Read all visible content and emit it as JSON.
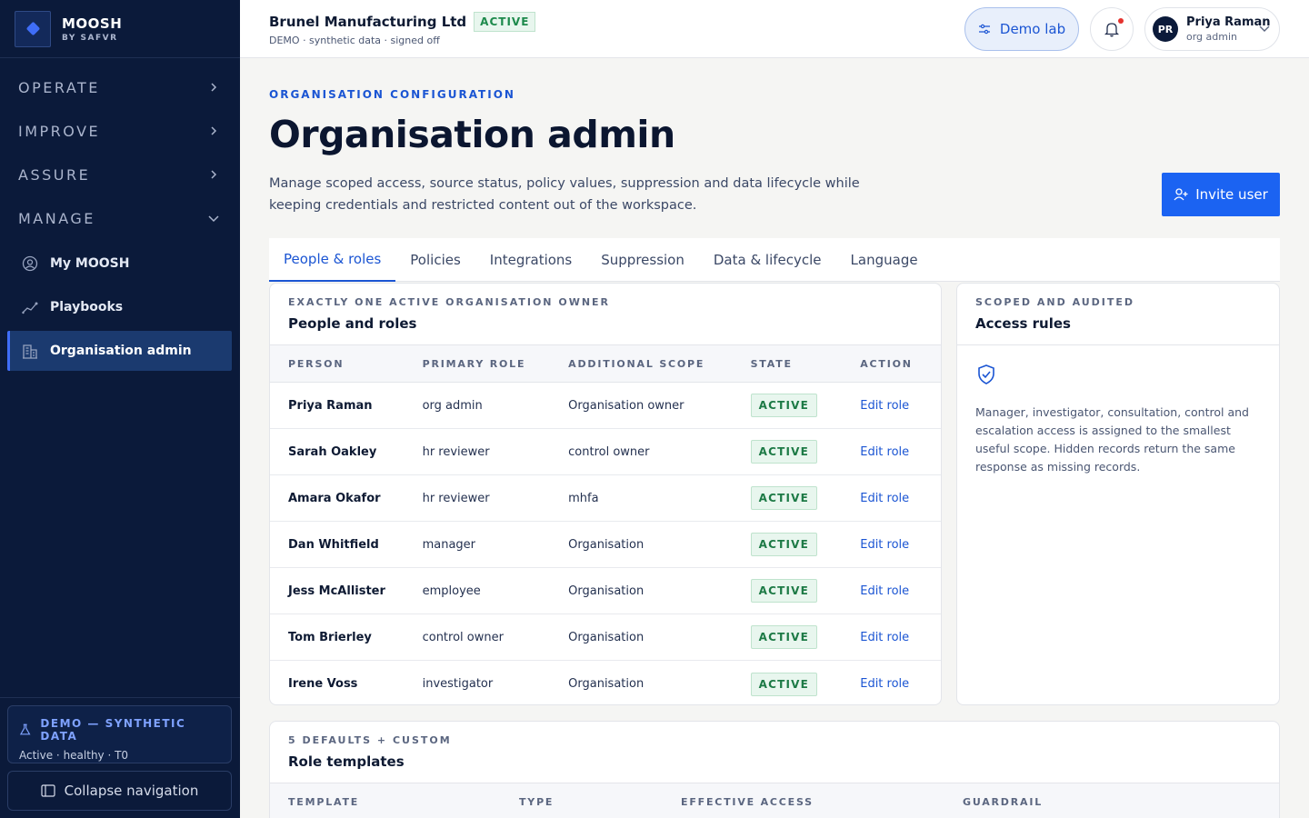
{
  "brand": {
    "name": "MOOSH",
    "sub": "BY SAFVR"
  },
  "sidebar": {
    "sections": [
      {
        "label": "OPERATE",
        "expanded": false
      },
      {
        "label": "IMPROVE",
        "expanded": false
      },
      {
        "label": "ASSURE",
        "expanded": false
      },
      {
        "label": "MANAGE",
        "expanded": true
      }
    ],
    "items": [
      {
        "label": "My MOOSH",
        "icon": "user-circle-icon"
      },
      {
        "label": "Playbooks",
        "icon": "trend-icon"
      },
      {
        "label": "Organisation admin",
        "icon": "building-icon",
        "active": true
      }
    ],
    "demo": {
      "title": "DEMO — SYNTHETIC DATA",
      "status": "Active · healthy · T0"
    },
    "collapse_label": "Collapse navigation"
  },
  "header": {
    "org_name": "Brunel Manufacturing Ltd",
    "org_status": "ACTIVE",
    "org_sub": "DEMO · synthetic data · signed off",
    "demo_lab_label": "Demo lab",
    "user": {
      "initials": "PR",
      "name": "Priya Raman",
      "role": "org admin"
    }
  },
  "page": {
    "eyebrow": "ORGANISATION CONFIGURATION",
    "title": "Organisation admin",
    "description": "Manage scoped access, source status, policy values, suppression and data lifecycle while keeping credentials and restricted content out of the workspace.",
    "invite_label": "Invite user"
  },
  "tabs": [
    "People & roles",
    "Policies",
    "Integrations",
    "Suppression",
    "Data & lifecycle",
    "Language"
  ],
  "people_card": {
    "eyebrow": "EXACTLY ONE ACTIVE ORGANISATION OWNER",
    "title": "People and roles",
    "columns": [
      "PERSON",
      "PRIMARY ROLE",
      "ADDITIONAL SCOPE",
      "STATE",
      "ACTION"
    ],
    "rows": [
      {
        "person": "Priya Raman",
        "role": "org admin",
        "scope": "Organisation owner",
        "state": "ACTIVE",
        "action": "Edit role"
      },
      {
        "person": "Sarah Oakley",
        "role": "hr reviewer",
        "scope": "control owner",
        "state": "ACTIVE",
        "action": "Edit role"
      },
      {
        "person": "Amara Okafor",
        "role": "hr reviewer",
        "scope": "mhfa",
        "state": "ACTIVE",
        "action": "Edit role"
      },
      {
        "person": "Dan Whitfield",
        "role": "manager",
        "scope": "Organisation",
        "state": "ACTIVE",
        "action": "Edit role"
      },
      {
        "person": "Jess McAllister",
        "role": "employee",
        "scope": "Organisation",
        "state": "ACTIVE",
        "action": "Edit role"
      },
      {
        "person": "Tom Brierley",
        "role": "control owner",
        "scope": "Organisation",
        "state": "ACTIVE",
        "action": "Edit role"
      },
      {
        "person": "Irene Voss",
        "role": "investigator",
        "scope": "Organisation",
        "state": "ACTIVE",
        "action": "Edit role"
      }
    ]
  },
  "access_card": {
    "eyebrow": "SCOPED AND AUDITED",
    "title": "Access rules",
    "icon": "shield-check-icon",
    "text": "Manager, investigator, consultation, control and escalation access is assigned to the smallest useful scope. Hidden records return the same response as missing records."
  },
  "templates_card": {
    "eyebrow": "5 DEFAULTS + CUSTOM",
    "title": "Role templates",
    "columns": [
      "TEMPLATE",
      "TYPE",
      "EFFECTIVE ACCESS",
      "GUARDRAIL"
    ]
  },
  "colors": {
    "sidebar": "#0b1a3a",
    "accent": "#1b63f2",
    "active_green": "#1d7a46"
  }
}
